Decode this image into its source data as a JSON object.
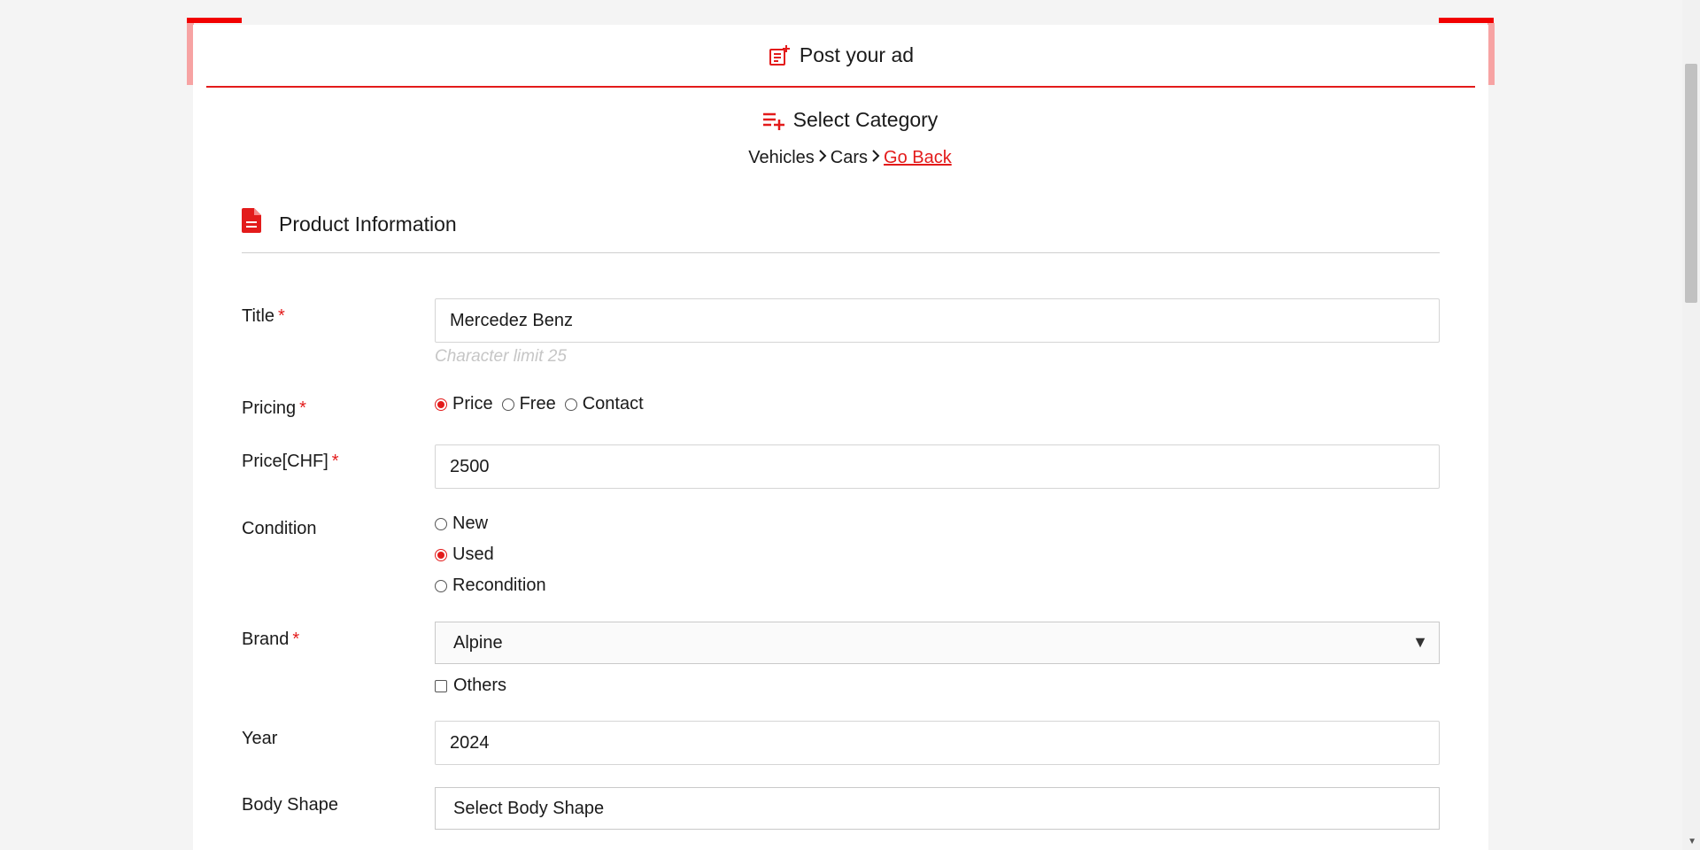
{
  "header": {
    "title": "Post your ad",
    "icon": "post-ad-icon"
  },
  "category": {
    "title": "Select Category",
    "icon": "playlist-add-icon",
    "breadcrumb": [
      "Vehicles",
      "Cars"
    ],
    "go_back": "Go Back"
  },
  "section": {
    "title": "Product Information",
    "icon": "document-icon"
  },
  "fields": {
    "title": {
      "label": "Title",
      "required": "*",
      "value": "Mercedez Benz",
      "hint": "Character limit 25"
    },
    "pricing": {
      "label": "Pricing",
      "required": "*",
      "options": [
        "Price",
        "Free",
        "Contact"
      ],
      "selected": "Price"
    },
    "price": {
      "label": "Price[CHF]",
      "required": "*",
      "value": "2500"
    },
    "condition": {
      "label": "Condition",
      "options": [
        "New",
        "Used",
        "Recondition"
      ],
      "selected": "Used"
    },
    "brand": {
      "label": "Brand",
      "required": "*",
      "value": "Alpine",
      "others_label": "Others"
    },
    "year": {
      "label": "Year",
      "value": "2024"
    },
    "body_shape": {
      "label": "Body Shape",
      "value": "Select Body Shape"
    }
  },
  "colors": {
    "accent": "#e31b1b",
    "background": "#f4f4f4"
  }
}
